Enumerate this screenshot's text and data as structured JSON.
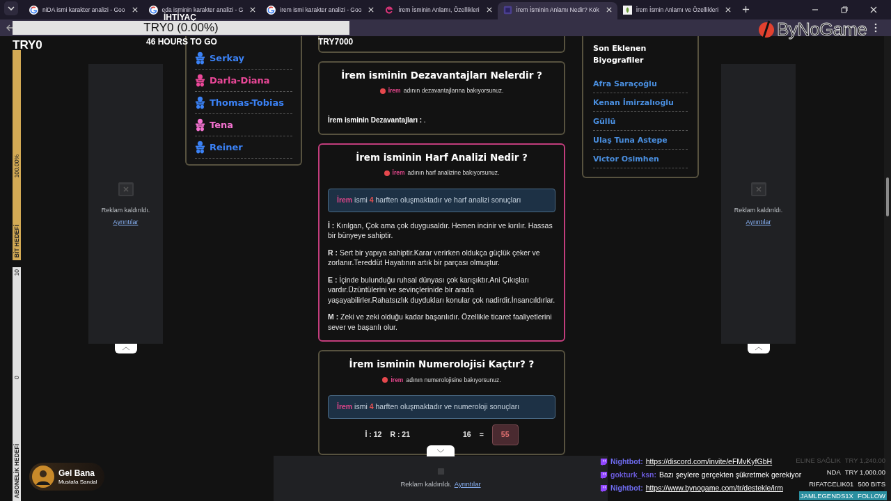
{
  "browser": {
    "tabs": [
      {
        "title": "niDA ismi karakter analizi - Goo",
        "kind": "google",
        "selected": false
      },
      {
        "title": "eda isminin karakter analizi - G",
        "kind": "google",
        "selected": false
      },
      {
        "title": "irem ismi karakter analizi - Goo",
        "kind": "google",
        "selected": false
      },
      {
        "title": "İrem İsminin Anlamı, Özellikleri",
        "kind": "letter",
        "selected": false
      },
      {
        "title": "İrem İsminin Anlamı Nedir? Kök",
        "kind": "square",
        "selected": true
      },
      {
        "title": "İrem İsmin Anlamı ve Özellikleri",
        "kind": "leaf",
        "selected": false
      }
    ]
  },
  "overlay": {
    "goal": {
      "label": "İHTİYAÇ",
      "progress": "TRY0 (0.00%)",
      "level": 0,
      "raised": "TRY0",
      "time_left": "46 HOURS TO GO",
      "target": "TRY7000"
    },
    "bit_goal": {
      "percent": "100.00%",
      "label": "BİT HEDEFİ",
      "level": 1
    },
    "sub_goal": {
      "max": "10",
      "min": "0",
      "label": "ABONELİK HEDEFİ",
      "level": 0
    },
    "logo": "ByNoGame",
    "now_playing": {
      "title": "Gel Bana",
      "artist": "Mustafa Sandal"
    },
    "chat": [
      {
        "user": "Nightbot:",
        "color": "#6f6cf0",
        "text": "https://discord.com/invite/eFMvKyfGbH",
        "kind": "link"
      },
      {
        "user": "gokturk_ksn:",
        "color": "#6a5ad8",
        "text": "Bazı şeylere gerçekten şükretmek gerekiyor",
        "kind": "text"
      },
      {
        "user": "Nightbot:",
        "color": "#6f6cf0",
        "text": "https://www.bynogame.com/tr/destekle/irm",
        "kind": "link"
      }
    ],
    "alerts": [
      {
        "name": "ELINE SAĞLIK",
        "amount": "TRY 1,240.00",
        "highlighted": false
      },
      {
        "name": "NDA",
        "amount": "TRY 1,000.00",
        "highlighted": false
      },
      {
        "name": "RIFATCELIK01",
        "amount": "500 BITS",
        "highlighted": false
      },
      {
        "name": "JAMLEGENDS1X",
        "amount": "FOLLOW",
        "highlighted": true
      }
    ]
  },
  "page": {
    "left_ad": {
      "text": "Reklam kaldırıldı.",
      "link": "Ayrıntılar"
    },
    "sidebar": {
      "items": [
        {
          "name": "Serkay",
          "color": "#3b82f6"
        },
        {
          "name": "Darla-Diana",
          "color": "#ec4899"
        },
        {
          "name": "Thomas-Tobias",
          "color": "#3b82f6"
        },
        {
          "name": "Tena",
          "color": "#f472d0"
        },
        {
          "name": "Reiner",
          "color": "#3b82f6"
        }
      ]
    },
    "cards": [
      {
        "title": "İrem isminin Dezavantajları Nelerdir ?",
        "highlighted": false,
        "note_name": "İrem",
        "note": "adının dezavantajlarına bakıyorsunuz.",
        "body": "**İrem isminin Dezavantajları :** ."
      },
      {
        "title": "İrem isminin Harf Analizi Nedir ?",
        "highlighted": true,
        "note_name": "İrem",
        "note": "adının harf analizine bakıyorsunuz.",
        "info": {
          "name": "İrem",
          "word": "ismi",
          "count": "4",
          "rest": "harften oluşmaktadır ve harf analizi sonuçları"
        },
        "letters": [
          {
            "letter": "İ :",
            "text": "Kırılgan, Çok ama çok duygusaldır. Hemen incinir ve kırılır. Hassas bir bünyeye sahiptir."
          },
          {
            "letter": "R :",
            "text": "Sert bir yapıya sahiptir.Karar verirken oldukça güçlük çeker ve zorlanır.Tereddüt Hayatının artık bir parçası olmuştur."
          },
          {
            "letter": "E :",
            "text": "İçinde bulunduğu ruhsal dünyası çok karışıktır.Ani Çıkışları vardır.Üzüntülerini ve sevinçlerinide bir arada yaşayabilirler.Rahatsızlık duydukları konular çok nadirdir.İnsancıldırlar."
          },
          {
            "letter": "M :",
            "text": "Zeki ve zeki olduğu kadar başarılıdır. Özellikle ticaret faaliyetlerini sever ve başarılı olur."
          }
        ]
      },
      {
        "title": "İrem isminin Numerolojisi Kaçtır? ?",
        "highlighted": false,
        "note_name": "İrem",
        "note": "adının numerolojisine bakıyorsunuz.",
        "info": {
          "name": "İrem",
          "word": "ismi",
          "count": "4",
          "rest": "harften oluşmaktadır ve numeroloji sonuçları"
        },
        "numbers": [
          "İ : 12",
          "R : 21",
          "16",
          "="
        ],
        "total": "55"
      }
    ],
    "recent": {
      "title": "Son Eklenen Biyografiler",
      "items": [
        "Afra Saraçoğlu",
        "Kenan İmirzalıoğlu",
        "Güllü",
        "Ulaş Tuna Astepe",
        "Victor Osimhen"
      ]
    },
    "right_ad": {
      "text": "Reklam kaldırıldı.",
      "link": "Ayrıntılar"
    },
    "bottom_ad": {
      "text": "Reklam kaldırıldı.",
      "link": "Ayrıntılar"
    }
  }
}
